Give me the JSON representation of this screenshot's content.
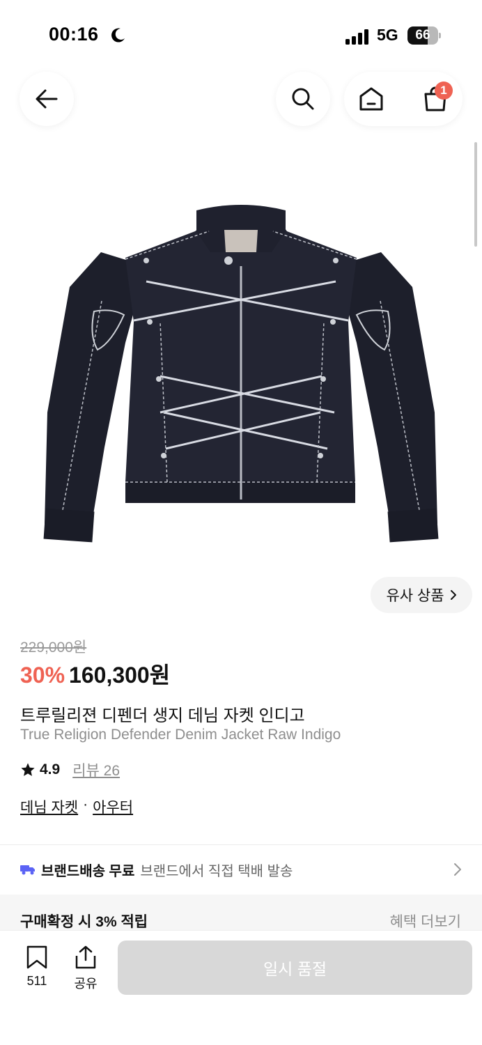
{
  "status_bar": {
    "time": "00:16",
    "network": "5G",
    "battery": "66",
    "battery_level": 0.66
  },
  "nav": {
    "back_icon": "arrow-left-icon",
    "search_icon": "search-icon",
    "home_icon": "home-icon",
    "bag_icon": "shopping-bag-icon",
    "cart_count": "1"
  },
  "similar": {
    "label": "유사 상품"
  },
  "product": {
    "original_price": "229,000원",
    "discount": "30%",
    "sale_price": "160,300원",
    "title_ko": "트루릴리젼 디펜더 생지 데님 자켓 인디고",
    "title_en": "True Religion Defender Denim Jacket Raw Indigo",
    "rating": "4.9",
    "review_label": "리뷰 26",
    "category": "데님 자켓",
    "category_sep": "·",
    "parent_category": "아우터"
  },
  "shipping": {
    "title": "브랜드배송 무료",
    "description": "브랜드에서 직접 택배 발송"
  },
  "benefit": {
    "title": "구매확정 시 3% 적립",
    "more": "혜택 더보기"
  },
  "bottom_bar": {
    "bookmark_count": "511",
    "share_label": "공유",
    "buy_label": "일시 품절"
  },
  "colors": {
    "accent_red": "#ef6253",
    "disabled_button": "#d8d8d8",
    "truck_blue": "#5b63f5"
  }
}
